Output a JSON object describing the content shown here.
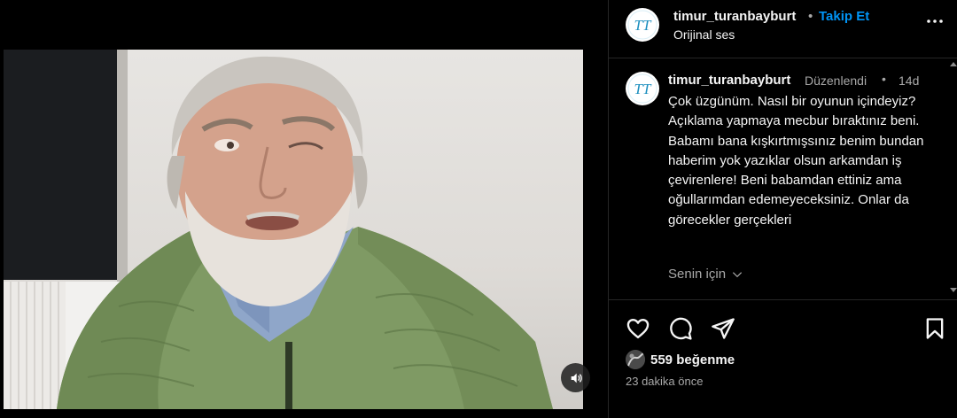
{
  "post": {
    "username": "timur_turanbayburt",
    "separator": "•",
    "follow_label": "Takip Et",
    "audio_label": "Orijinal ses"
  },
  "caption": {
    "username": "timur_turanbayburt",
    "edited_label": "Düzenlendi",
    "dot": "•",
    "age": "14d",
    "text": "Çok üzgünüm. Nasıl bir oyunun içindeyiz? Açıklama yapmaya mecbur bıraktınız beni. Babamı bana kışkırtmışsınız benim bundan haberim yok yazıklar olsun arkamdan iş çevirenlere! Beni babamdan ettiniz ama oğullarımdan edemeyeceksiniz. Onlar da görecekler gerçekleri",
    "for_you_label": "Senin için"
  },
  "engagement": {
    "likes_label": "559 beğenme",
    "time_label": "23 dakika önce"
  },
  "icons": {
    "more": "more-options-icon",
    "like": "heart-icon",
    "comment": "comment-icon",
    "share": "share-icon",
    "save": "bookmark-icon",
    "sound": "speaker-icon"
  },
  "colors": {
    "follow": "#0095f6",
    "secondary_text": "#a8a8a8",
    "background": "#000000",
    "jacket": "#7f9a64"
  }
}
